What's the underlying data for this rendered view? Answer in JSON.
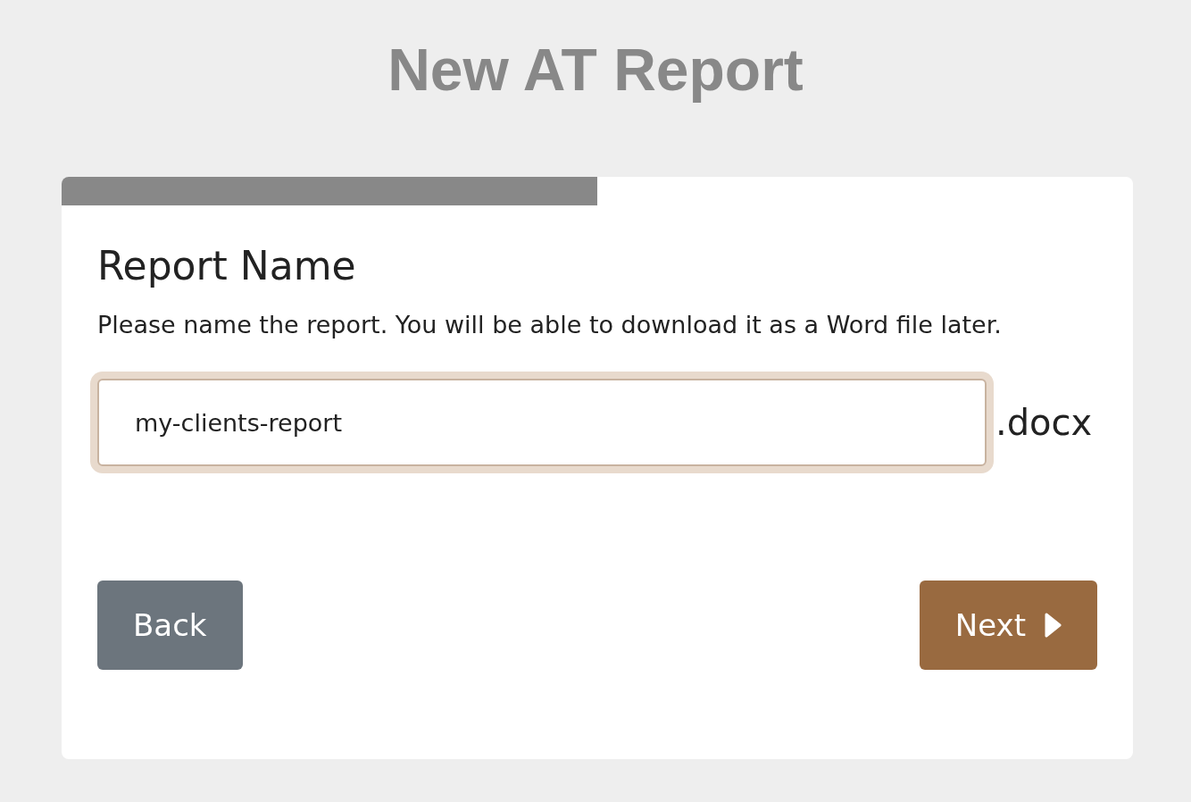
{
  "title": "New AT Report",
  "progress": {
    "level": 0.5
  },
  "step": {
    "heading": "Report Name",
    "description": "Please name the report. You will be able to download it as a Word file later."
  },
  "name_field": {
    "value": "my-clients-report",
    "focused": true,
    "suffix": ".docx"
  },
  "buttons": [
    {
      "kind": "back",
      "label": "Back"
    },
    {
      "kind": "next",
      "label": "Next"
    }
  ]
}
